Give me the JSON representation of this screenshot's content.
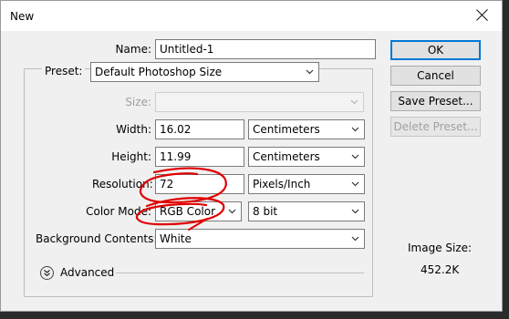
{
  "window": {
    "title": "New"
  },
  "form": {
    "name_label": "Name:",
    "name_value": "Untitled-1",
    "preset_label": "Preset:",
    "preset_value": "Default Photoshop Size",
    "size_label": "Size:",
    "size_value": "",
    "width_label": "Width:",
    "width_value": "16.02",
    "width_unit": "Centimeters",
    "height_label": "Height:",
    "height_value": "11.99",
    "height_unit": "Centimeters",
    "resolution_label": "Resolution:",
    "resolution_value": "72",
    "resolution_unit": "Pixels/Inch",
    "color_mode_label": "Color Mode:",
    "color_mode_value": "RGB Color",
    "bit_depth_value": "8 bit",
    "background_label": "Background Contents:",
    "background_value": "White",
    "advanced_label": "Advanced"
  },
  "buttons": {
    "ok": "OK",
    "cancel": "Cancel",
    "save_preset": "Save Preset...",
    "delete_preset": "Delete Preset..."
  },
  "image_size": {
    "label": "Image Size:",
    "value": "452.2K"
  },
  "colors": {
    "accent": "#0078d7",
    "annotation": "#e00000"
  },
  "icons": {
    "close": "close-icon",
    "dropdown": "chevron-down-icon",
    "advanced": "double-chevron-down-icon"
  }
}
